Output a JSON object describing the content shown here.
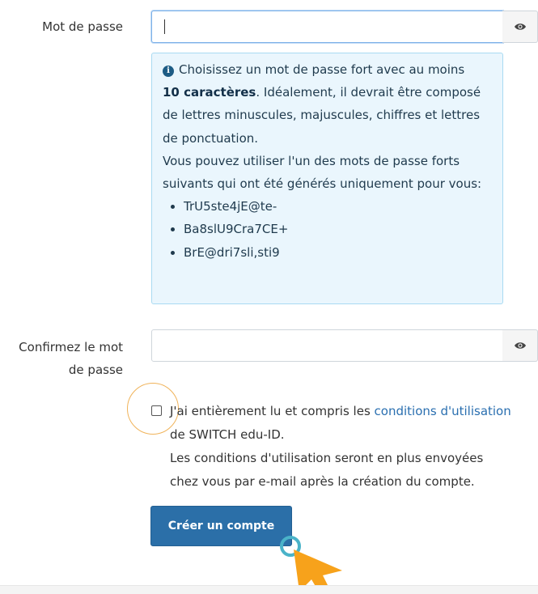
{
  "password": {
    "label": "Mot de passe",
    "value": "",
    "show_icon": "eye-icon"
  },
  "info": {
    "icon": "info-circle-icon",
    "line1": "Choisissez un mot de passe fort avec au moins",
    "min_chars": "10 caractères",
    "line1_rest": ". Idéalement, il devrait être composé de lettres minuscules, majuscules, chiffres et lettres de ponctuation.",
    "line2": "Vous pouvez utiliser l'un des mots de passe forts suivants qui ont été générés uniquement pour vous:",
    "suggestions": [
      "TrU5ste4jE@te-",
      "Ba8slU9Cra7CE+",
      "BrE@dri7sli,sti9"
    ]
  },
  "confirm": {
    "label_line1": "Confirmez le mot",
    "label_line2": "de passe",
    "value": "",
    "show_icon": "eye-icon"
  },
  "terms": {
    "text_before": "J'ai entièrement lu et compris les ",
    "link": "conditions d'utilisation",
    "text_after": "de SWITCH edu-ID.",
    "note_line1": "Les conditions d'utilisation seront en plus envoyées",
    "note_line2": "chez vous par e-mail après la création du compte."
  },
  "submit": {
    "label": "Créer un compte"
  },
  "colors": {
    "primary": "#2b6fa8",
    "info_bg": "#eaf6fd",
    "link": "#2a6fb0",
    "cursor_accent": "#f7a21b"
  }
}
